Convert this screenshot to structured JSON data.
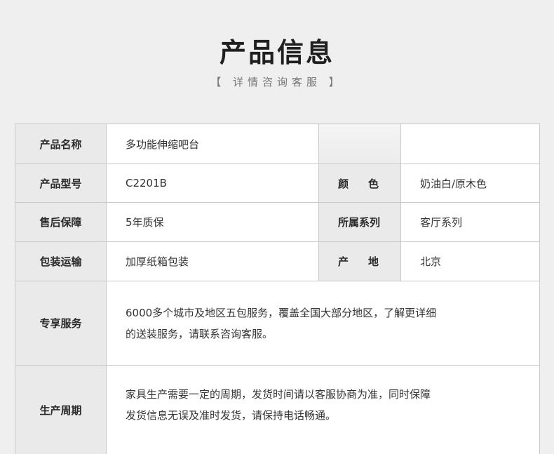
{
  "header": {
    "title": "产品信息",
    "subtitle": "【 详情咨询客服 】"
  },
  "rows": [
    {
      "label": "产品名称",
      "value": "多功能伸缩吧台"
    },
    {
      "label": "产品型号",
      "value": "C2201B",
      "label2": "颜色",
      "value2": "奶油白/原木色"
    },
    {
      "label": "售后保障",
      "value": "5年质保",
      "label2": "所属系列",
      "value2": "客厅系列"
    },
    {
      "label": "包装运输",
      "value": "加厚纸箱包装",
      "label2": "产地",
      "value2": "北京"
    },
    {
      "label": "专享服务",
      "value": "6000多个城市及地区五包服务，覆盖全国大部分地区，了解更详细\n的送装服务，请联系咨询客服。"
    },
    {
      "label": "生产周期",
      "value": "家具生产需要一定的周期，发货时间请以客服协商为准，同时保障\n发货信息无误及准时发货，请保持电话畅通。"
    }
  ]
}
